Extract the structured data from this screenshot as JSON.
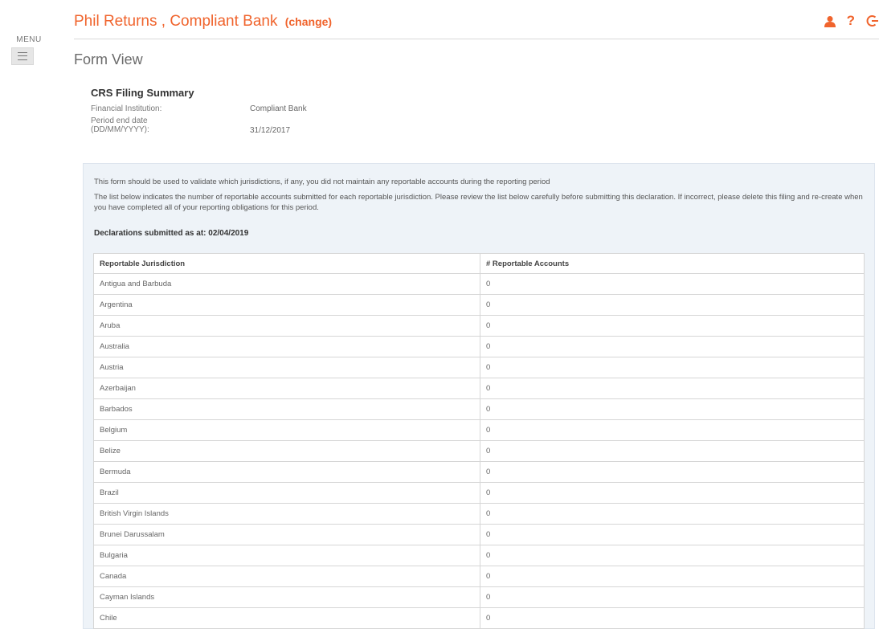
{
  "menu": {
    "label": "MENU"
  },
  "header": {
    "title": "Phil Returns , Compliant Bank",
    "change_label": "(change)",
    "icons": [
      "user-icon",
      "help-icon",
      "logout-icon"
    ],
    "accent": "#f0642d"
  },
  "page": {
    "title": "Form View"
  },
  "summary": {
    "title": "CRS Filing Summary",
    "fi_label": "Financial Institution:",
    "fi_value": "Compliant Bank",
    "date_label": "Period end date (DD/MM/YYYY):",
    "date_value": "31/12/2017"
  },
  "panel": {
    "text1": "This form should be used to validate which jurisdictions, if any, you did not maintain any reportable accounts during the reporting period",
    "text2": "The list below indicates the number of reportable accounts submitted for each reportable jurisdiction. Please review the list below carefully before submitting this declaration. If incorrect, please delete this filing and re-create when you have completed all of your reporting obligations for this period.",
    "declaration": "Declarations submitted as at: 02/04/2019"
  },
  "table": {
    "headers": [
      "Reportable Jurisdiction",
      "# Reportable Accounts"
    ],
    "rows": [
      [
        "Antigua and Barbuda",
        "0"
      ],
      [
        "Argentina",
        "0"
      ],
      [
        "Aruba",
        "0"
      ],
      [
        "Australia",
        "0"
      ],
      [
        "Austria",
        "0"
      ],
      [
        "Azerbaijan",
        "0"
      ],
      [
        "Barbados",
        "0"
      ],
      [
        "Belgium",
        "0"
      ],
      [
        "Belize",
        "0"
      ],
      [
        "Bermuda",
        "0"
      ],
      [
        "Brazil",
        "0"
      ],
      [
        "British Virgin Islands",
        "0"
      ],
      [
        "Brunei Darussalam",
        "0"
      ],
      [
        "Bulgaria",
        "0"
      ],
      [
        "Canada",
        "0"
      ],
      [
        "Cayman Islands",
        "0"
      ],
      [
        "Chile",
        "0"
      ]
    ]
  }
}
